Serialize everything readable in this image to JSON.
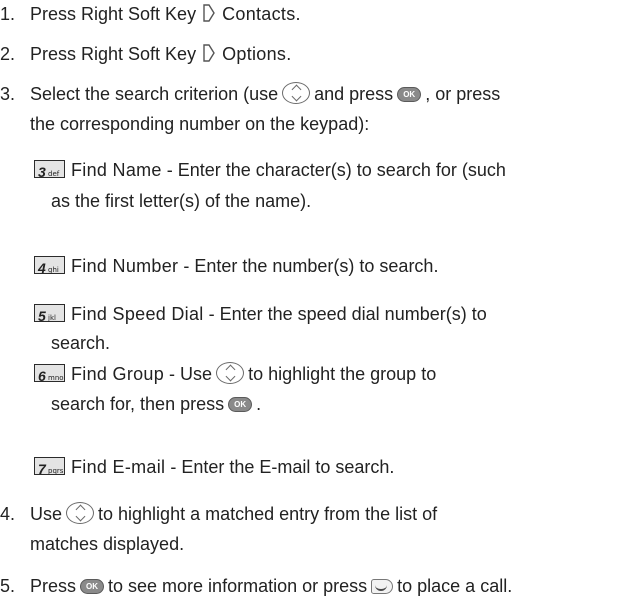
{
  "steps": [
    {
      "num": "1.",
      "pre": "Press Right Soft Key",
      "menu": "Contacts",
      "post": "."
    },
    {
      "num": "2.",
      "pre": "Press Right Soft Key",
      "menu": "Options",
      "post": "."
    },
    {
      "num": "3.",
      "line1_a": "Select the search criterion (use",
      "line1_b": "and press",
      "line1_c": ", or press",
      "line2": "the corresponding number on the keypad):"
    },
    {
      "num": "4.",
      "line1_a": "Use",
      "line1_b": "to highlight a matched entry from the list of",
      "line2": "matches displayed."
    },
    {
      "num": "5.",
      "a": "Press",
      "b": "to see more information or press",
      "c": "to place a call."
    }
  ],
  "options": [
    {
      "digit": "3",
      "letters": "def",
      "title": "Find Name",
      "desc1": " - Enter the character(s) to search for (such",
      "desc2": "as the first letter(s) of the name)."
    },
    {
      "digit": "4",
      "letters": "ghi",
      "title": "Find Number",
      "desc1": " - Enter the number(s) to search."
    },
    {
      "digit": "5",
      "letters": "jkl",
      "title": "Find Speed Dial",
      "desc1": " - Enter the speed dial number(s) to",
      "desc2": "search."
    },
    {
      "digit": "6",
      "letters": "mno",
      "title": "Find Group",
      "desc1a": " - Use",
      "desc1b": "to highlight the group to",
      "desc2": "search for, then press",
      "desc2_end": "."
    },
    {
      "digit": "7",
      "letters": "pqrs",
      "title": "Find E-mail",
      "desc1": " - Enter the E-mail to search."
    }
  ],
  "icons": {
    "ok_label": "OK",
    "send_label": "SEND"
  }
}
